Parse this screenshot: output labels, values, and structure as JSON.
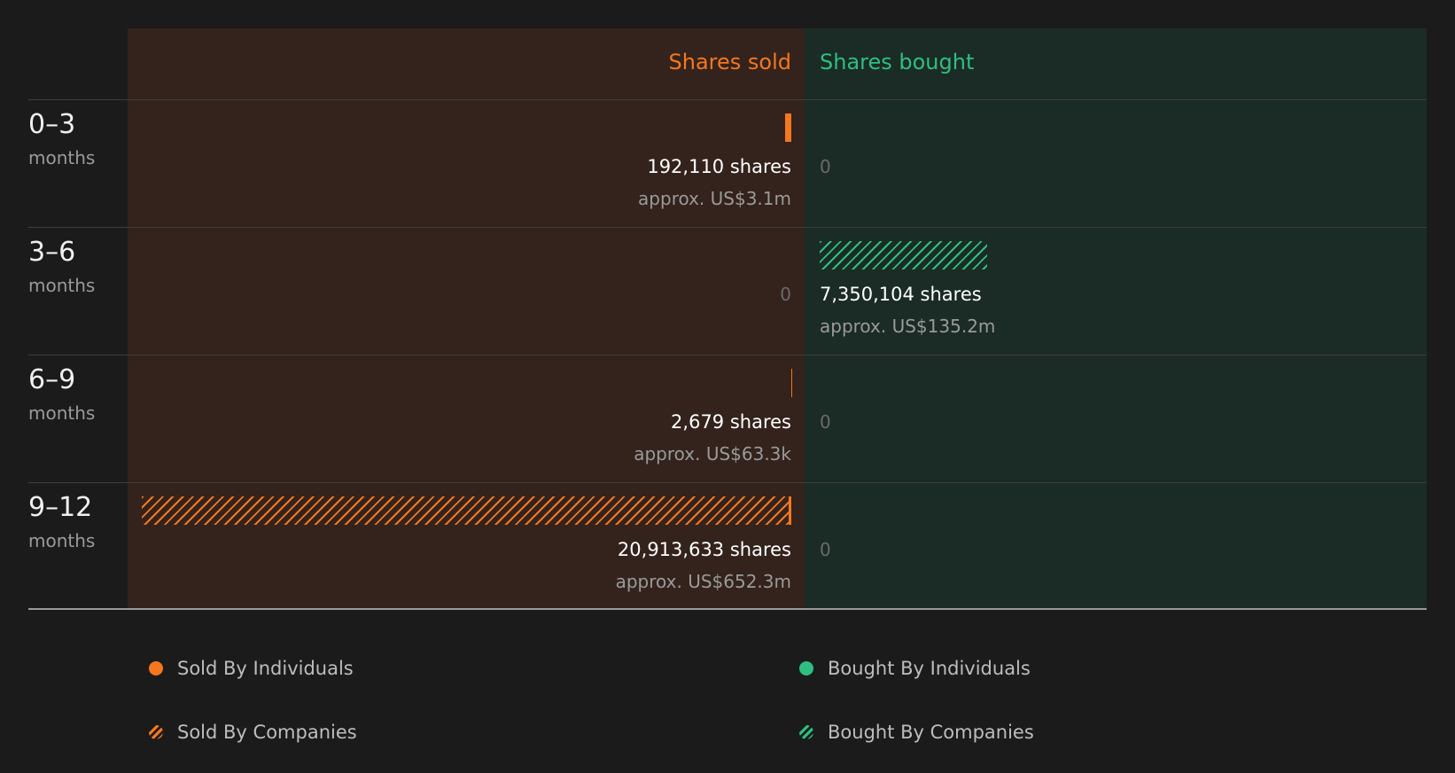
{
  "colors": {
    "sold": "#f5771f",
    "bought": "#2ebf80"
  },
  "headers": {
    "sold": "Shares sold",
    "bought": "Shares bought"
  },
  "rows": [
    {
      "period": "0–3",
      "unit": "months",
      "sold": {
        "shares": "192,110 shares",
        "value": "approx. US$3.1m"
      },
      "bought": {
        "zero": "0"
      }
    },
    {
      "period": "3–6",
      "unit": "months",
      "sold": {
        "zero": "0"
      },
      "bought": {
        "shares": "7,350,104 shares",
        "value": "approx. US$135.2m"
      }
    },
    {
      "period": "6–9",
      "unit": "months",
      "sold": {
        "shares": "2,679 shares",
        "value": "approx. US$63.3k"
      },
      "bought": {
        "zero": "0"
      }
    },
    {
      "period": "9–12",
      "unit": "months",
      "sold": {
        "shares": "20,913,633 shares",
        "value": "approx. US$652.3m"
      },
      "bought": {
        "zero": "0"
      }
    }
  ],
  "legend": {
    "sold_individuals": "Sold By Individuals",
    "sold_companies": "Sold By Companies",
    "bought_individuals": "Bought By Individuals",
    "bought_companies": "Bought By Companies"
  },
  "chart_data": {
    "type": "bar",
    "categories": [
      "0–3 months",
      "3–6 months",
      "6–9 months",
      "9–12 months"
    ],
    "series": [
      {
        "name": "Sold By Individuals",
        "values": [
          192110,
          0,
          2679,
          0
        ]
      },
      {
        "name": "Sold By Companies",
        "values": [
          0,
          0,
          0,
          20913633
        ]
      },
      {
        "name": "Bought By Individuals",
        "values": [
          0,
          0,
          0,
          0
        ]
      },
      {
        "name": "Bought By Companies",
        "values": [
          0,
          7350104,
          0,
          0
        ]
      }
    ],
    "title": "",
    "xlabel": "",
    "ylabel": "",
    "legend_position": "bottom"
  }
}
